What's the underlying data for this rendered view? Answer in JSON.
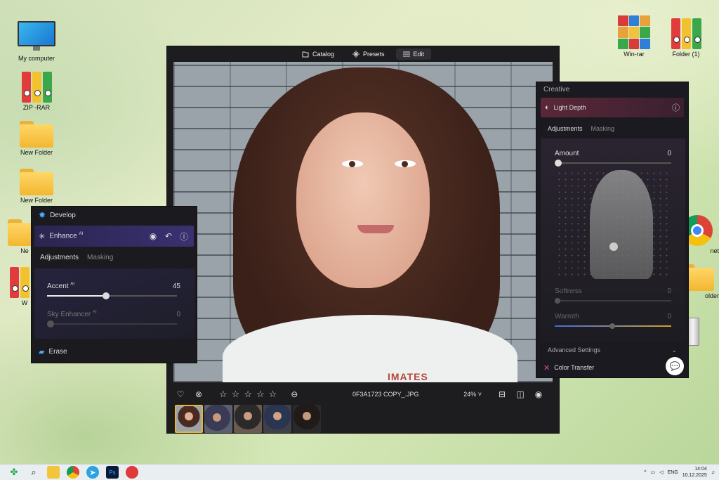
{
  "desktop": {
    "icons_left": [
      {
        "label": "My computer"
      },
      {
        "label": "ZIP -RAR"
      },
      {
        "label": "New Folder"
      },
      {
        "label": "New Folder"
      },
      {
        "label": "Ne"
      },
      {
        "label": "W"
      }
    ],
    "icons_right": [
      {
        "label": "Win-rar"
      },
      {
        "label": "Folder (1)"
      },
      {
        "label": "net"
      },
      {
        "label": "older"
      }
    ]
  },
  "editor": {
    "tabs": [
      {
        "label": "Catalog",
        "icon": "folder-icon"
      },
      {
        "label": "Presets",
        "icon": "sparkle-icon"
      },
      {
        "label": "Edit",
        "icon": "sliders-icon"
      }
    ],
    "active_tab": "Edit",
    "photo_text": "IMATES",
    "filename": "0F3A1723 COPY_.JPG",
    "zoom": "24%",
    "zoom_arrow": "˅",
    "rating_stars": 5,
    "thumbnails": 5
  },
  "develop_panel": {
    "title": "Develop",
    "enhance_label": "Enhance",
    "ai_tag": "AI",
    "tabs": [
      "Adjustments",
      "Masking"
    ],
    "sliders": [
      {
        "label": "Accent",
        "value": "45",
        "level": 0.45
      },
      {
        "label": "Sky Enhancer",
        "value": "0",
        "level": 0
      }
    ],
    "erase_label": "Erase"
  },
  "creative_panel": {
    "title": "Creative",
    "feature_label": "Light Depth",
    "tabs": [
      "Adjustments",
      "Masking"
    ],
    "sliders": [
      {
        "label": "Amount",
        "value": "0"
      },
      {
        "label": "Softness",
        "value": "0"
      },
      {
        "label": "Warmth",
        "value": "0"
      }
    ],
    "advanced_label": "Advanced Settings",
    "color_transfer_label": "Color Transfer"
  },
  "taskbar": {
    "lang": "ENG",
    "time": "14:04",
    "date": "10.12.2025"
  },
  "colors": {
    "enhance_bg": "#3a3170",
    "light_depth_bg": "#5a2838",
    "accent_yellow": "#e7b33a"
  }
}
